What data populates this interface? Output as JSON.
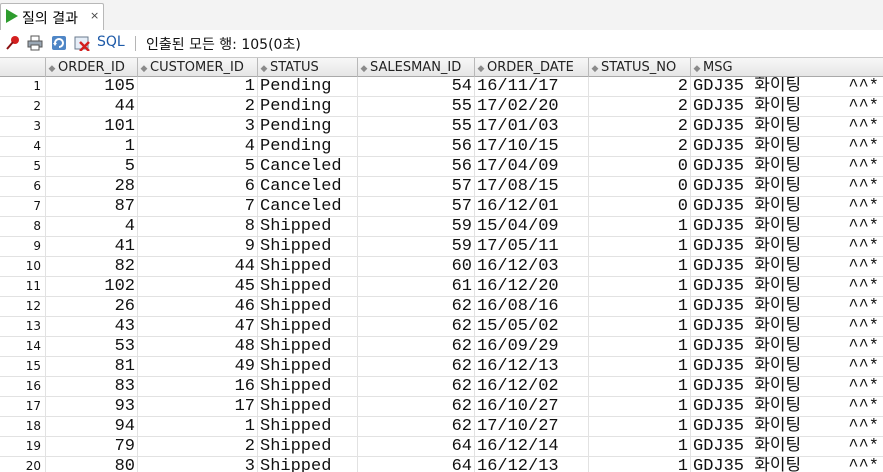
{
  "tab": {
    "label": "질의 결과",
    "close": "×"
  },
  "toolbar": {
    "sql_label": "SQL",
    "status": "인출된 모든 행: 105(0초)"
  },
  "grid": {
    "columns": [
      "ORDER_ID",
      "CUSTOMER_ID",
      "STATUS",
      "SALESMAN_ID",
      "ORDER_DATE",
      "STATUS_NO",
      "MSG"
    ],
    "rows": [
      {
        "n": "1",
        "order_id": "105",
        "customer_id": "1",
        "status": "Pending",
        "salesman_id": "54",
        "order_date": "16/11/17",
        "status_no": "2",
        "msg": "GDJ35 화이팅",
        "emo": "^^*"
      },
      {
        "n": "2",
        "order_id": "44",
        "customer_id": "2",
        "status": "Pending",
        "salesman_id": "55",
        "order_date": "17/02/20",
        "status_no": "2",
        "msg": "GDJ35 화이팅",
        "emo": "^^*"
      },
      {
        "n": "3",
        "order_id": "101",
        "customer_id": "3",
        "status": "Pending",
        "salesman_id": "55",
        "order_date": "17/01/03",
        "status_no": "2",
        "msg": "GDJ35 화이팅",
        "emo": "^^*"
      },
      {
        "n": "4",
        "order_id": "1",
        "customer_id": "4",
        "status": "Pending",
        "salesman_id": "56",
        "order_date": "17/10/15",
        "status_no": "2",
        "msg": "GDJ35 화이팅",
        "emo": "^^*"
      },
      {
        "n": "5",
        "order_id": "5",
        "customer_id": "5",
        "status": "Canceled",
        "salesman_id": "56",
        "order_date": "17/04/09",
        "status_no": "0",
        "msg": "GDJ35 화이팅",
        "emo": "^^*"
      },
      {
        "n": "6",
        "order_id": "28",
        "customer_id": "6",
        "status": "Canceled",
        "salesman_id": "57",
        "order_date": "17/08/15",
        "status_no": "0",
        "msg": "GDJ35 화이팅",
        "emo": "^^*"
      },
      {
        "n": "7",
        "order_id": "87",
        "customer_id": "7",
        "status": "Canceled",
        "salesman_id": "57",
        "order_date": "16/12/01",
        "status_no": "0",
        "msg": "GDJ35 화이팅",
        "emo": "^^*"
      },
      {
        "n": "8",
        "order_id": "4",
        "customer_id": "8",
        "status": "Shipped",
        "salesman_id": "59",
        "order_date": "15/04/09",
        "status_no": "1",
        "msg": "GDJ35 화이팅",
        "emo": "^^*"
      },
      {
        "n": "9",
        "order_id": "41",
        "customer_id": "9",
        "status": "Shipped",
        "salesman_id": "59",
        "order_date": "17/05/11",
        "status_no": "1",
        "msg": "GDJ35 화이팅",
        "emo": "^^*"
      },
      {
        "n": "10",
        "order_id": "82",
        "customer_id": "44",
        "status": "Shipped",
        "salesman_id": "60",
        "order_date": "16/12/03",
        "status_no": "1",
        "msg": "GDJ35 화이팅",
        "emo": "^^*"
      },
      {
        "n": "11",
        "order_id": "102",
        "customer_id": "45",
        "status": "Shipped",
        "salesman_id": "61",
        "order_date": "16/12/20",
        "status_no": "1",
        "msg": "GDJ35 화이팅",
        "emo": "^^*"
      },
      {
        "n": "12",
        "order_id": "26",
        "customer_id": "46",
        "status": "Shipped",
        "salesman_id": "62",
        "order_date": "16/08/16",
        "status_no": "1",
        "msg": "GDJ35 화이팅",
        "emo": "^^*"
      },
      {
        "n": "13",
        "order_id": "43",
        "customer_id": "47",
        "status": "Shipped",
        "salesman_id": "62",
        "order_date": "15/05/02",
        "status_no": "1",
        "msg": "GDJ35 화이팅",
        "emo": "^^*"
      },
      {
        "n": "14",
        "order_id": "53",
        "customer_id": "48",
        "status": "Shipped",
        "salesman_id": "62",
        "order_date": "16/09/29",
        "status_no": "1",
        "msg": "GDJ35 화이팅",
        "emo": "^^*"
      },
      {
        "n": "15",
        "order_id": "81",
        "customer_id": "49",
        "status": "Shipped",
        "salesman_id": "62",
        "order_date": "16/12/13",
        "status_no": "1",
        "msg": "GDJ35 화이팅",
        "emo": "^^*"
      },
      {
        "n": "16",
        "order_id": "83",
        "customer_id": "16",
        "status": "Shipped",
        "salesman_id": "62",
        "order_date": "16/12/02",
        "status_no": "1",
        "msg": "GDJ35 화이팅",
        "emo": "^^*"
      },
      {
        "n": "17",
        "order_id": "93",
        "customer_id": "17",
        "status": "Shipped",
        "salesman_id": "62",
        "order_date": "16/10/27",
        "status_no": "1",
        "msg": "GDJ35 화이팅",
        "emo": "^^*"
      },
      {
        "n": "18",
        "order_id": "94",
        "customer_id": "1",
        "status": "Shipped",
        "salesman_id": "62",
        "order_date": "17/10/27",
        "status_no": "1",
        "msg": "GDJ35 화이팅",
        "emo": "^^*"
      },
      {
        "n": "19",
        "order_id": "79",
        "customer_id": "2",
        "status": "Shipped",
        "salesman_id": "64",
        "order_date": "16/12/14",
        "status_no": "1",
        "msg": "GDJ35 화이팅",
        "emo": "^^*"
      },
      {
        "n": "20",
        "order_id": "80",
        "customer_id": "3",
        "status": "Shipped",
        "salesman_id": "64",
        "order_date": "16/12/13",
        "status_no": "1",
        "msg": "GDJ35 화이팅",
        "emo": "^^*"
      }
    ]
  }
}
